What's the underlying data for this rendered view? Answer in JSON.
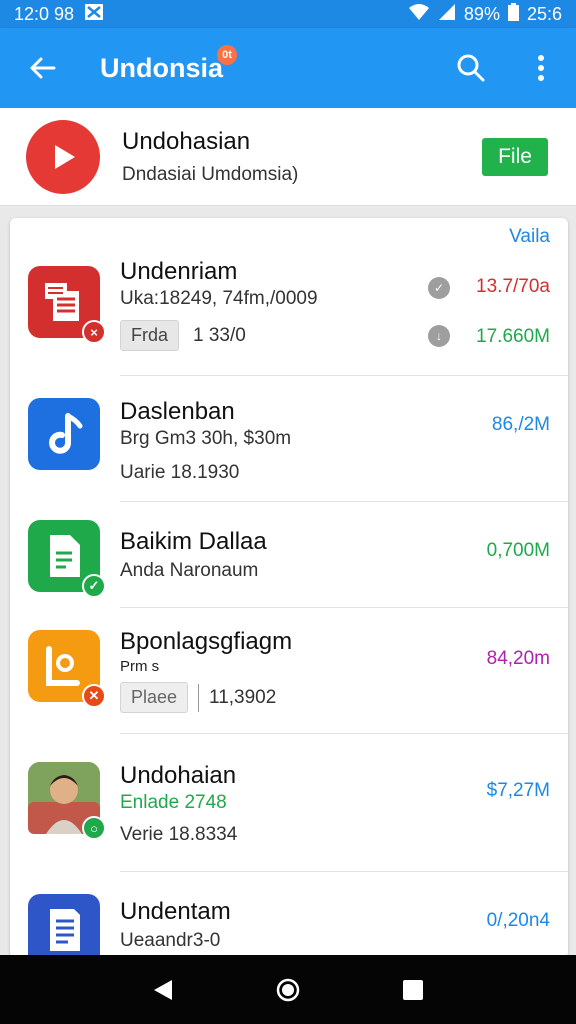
{
  "status_bar": {
    "time": "12:0 98",
    "battery": "89%",
    "clock": "25:6"
  },
  "app_bar": {
    "title": "Undonsia",
    "title_badge": "0t"
  },
  "header": {
    "title": "Undohasian",
    "subtitle": "Dndasiai Umdomsia)",
    "button_label": "File"
  },
  "list": {
    "corner_link": "Vaila",
    "items": [
      {
        "name": "Undenriam",
        "line1": "Uka:18249, 74fm,/0009",
        "chip": "Frda",
        "line2": "1 33/0",
        "size_top": "13.7/70a",
        "size_bottom": "17.660M",
        "icon": "document-stack-icon",
        "icon_color": "#d32f2f"
      },
      {
        "name": "Daslenban",
        "line1": "Brg Gm3 30h, $30m",
        "line2": "Uarie 18.1930",
        "size": "86,/2M",
        "icon": "music-note-icon",
        "icon_color": "#1e6fe0"
      },
      {
        "name": "Baikim Dallaa",
        "line1": "Anda Naronaum",
        "size": "0,700M",
        "icon": "file-check-icon",
        "icon_color": "#1fa94a"
      },
      {
        "name": "Bponlagsgfiagm",
        "line1": "Prm s",
        "chip": "Plaee",
        "line2": "11,3902",
        "size": "84,20m",
        "icon": "location-card-icon",
        "icon_color": "#f59b12"
      },
      {
        "name": "Undohaian",
        "line1": "Enlade 2748",
        "line2": "Verie  18.8334",
        "size": "$7,27M",
        "icon": "person-photo-icon",
        "icon_color": "#6a8f4e"
      },
      {
        "name": "Undentam",
        "line1": "Ueaandr3-0",
        "size": "0/,20n4",
        "icon": "document-lines-icon",
        "icon_color": "#2f56c9"
      }
    ]
  },
  "colors": {
    "primary": "#2196f3",
    "status": "#1e88e5",
    "green": "#1fa94a",
    "red": "#d32f2f",
    "purple": "#b020b0",
    "blue_text": "#1e88e5"
  }
}
